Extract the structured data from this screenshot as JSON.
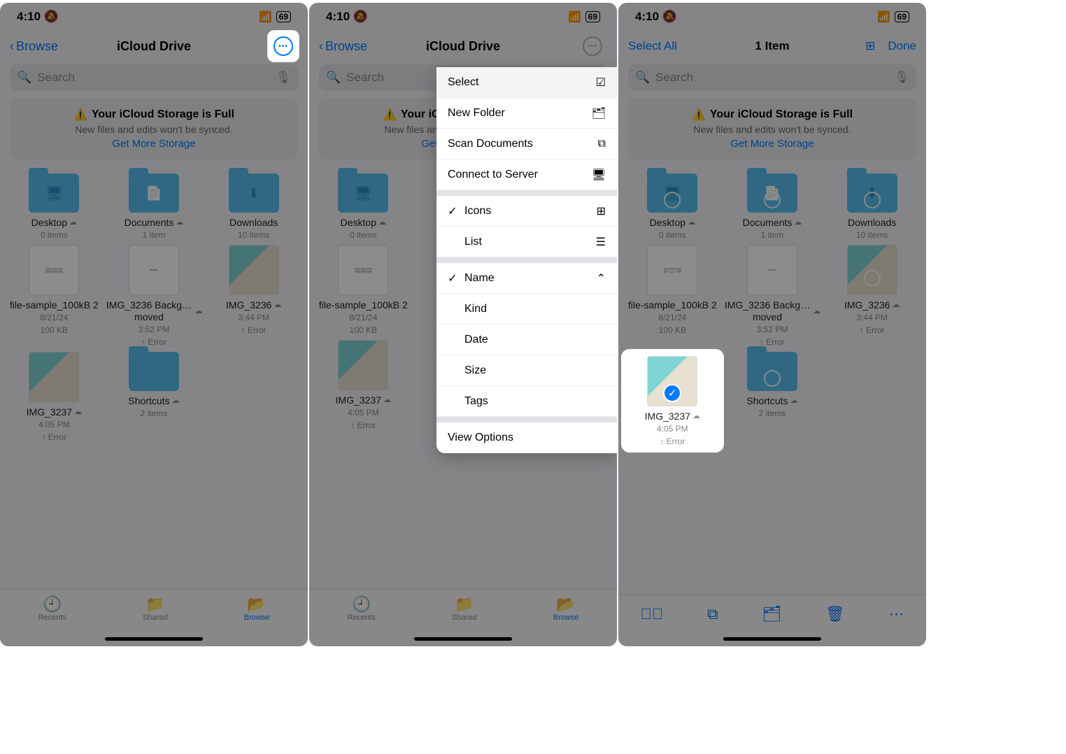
{
  "status": {
    "time": "4:10",
    "battery": "69"
  },
  "nav": {
    "back": "Browse",
    "title": "iCloud Drive"
  },
  "search": {
    "placeholder": "Search"
  },
  "banner": {
    "title": "Your iCloud Storage is Full",
    "sub": "New files and edits won't be synced.",
    "link": "Get More Storage"
  },
  "folders": [
    {
      "name": "Desktop",
      "meta": "0 items"
    },
    {
      "name": "Documents",
      "meta": "1 item"
    },
    {
      "name": "Downloads",
      "meta": "10 items"
    }
  ],
  "files": [
    {
      "name": "file-sample_100kB 2",
      "m1": "8/21/24",
      "m2": "100 KB"
    },
    {
      "name": "IMG_3236 Backg…moved",
      "m1": "3:52 PM",
      "m2": "↑ Error"
    },
    {
      "name": "IMG_3236",
      "m1": "3:44 PM",
      "m2": "↑ Error"
    },
    {
      "name": "IMG_3237",
      "m1": "4:05 PM",
      "m2": "↑ Error"
    },
    {
      "name": "Shortcuts",
      "m1": "2 items",
      "m2": ""
    }
  ],
  "tabs": {
    "recents": "Recents",
    "shared": "Shared",
    "browse": "Browse"
  },
  "menu": {
    "select": "Select",
    "newfolder": "New Folder",
    "scan": "Scan Documents",
    "connect": "Connect to Server",
    "icons": "Icons",
    "list": "List",
    "name": "Name",
    "kind": "Kind",
    "date": "Date",
    "size": "Size",
    "tags": "Tags",
    "viewopts": "View Options"
  },
  "selmode": {
    "selectall": "Select All",
    "count": "1 Item",
    "done": "Done"
  }
}
